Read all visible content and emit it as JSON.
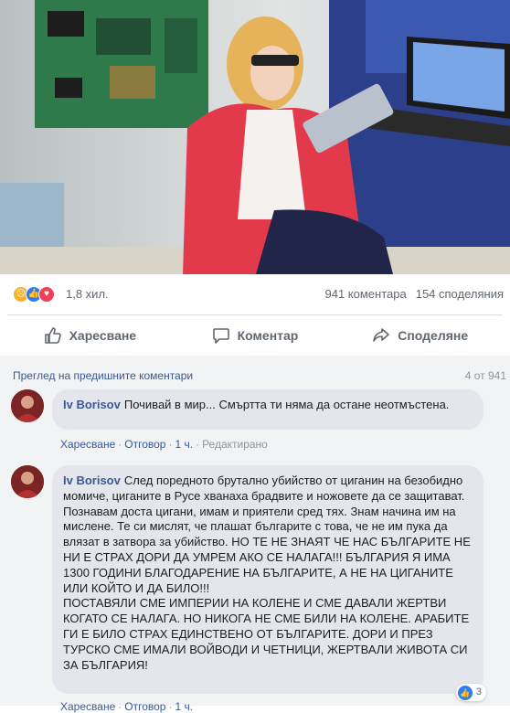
{
  "post": {
    "photo_alt": "Post photo",
    "reactions": {
      "icons": [
        "sad-reaction-icon",
        "like-reaction-icon",
        "love-reaction-icon"
      ],
      "count": "1,8 хил.",
      "comments_count": "941 коментара",
      "shares_count": "154 споделяния"
    },
    "actions": {
      "like": "Харесване",
      "comment": "Коментар",
      "share": "Споделяне"
    }
  },
  "comments": {
    "previous_link": "Преглед на предишните коментари",
    "position": "4 от 941",
    "items": [
      {
        "author": "Iv Borisov",
        "text": "Почивай в мир... Смъртта ти няма да остане неотмъстена.",
        "like": "Харесване",
        "reply": "Отговор",
        "time": "1 ч.",
        "edited": "Редактирано"
      },
      {
        "author": "Iv Borisov",
        "text": "След поредното брутално убийство от циганин на безобидно момиче, циганите в Русе хванаха брадвите и ножовете да се защитават. Познавам доста цигани, имам и приятели сред тях. Знам начина им на мислене. Те си мислят, че плашат българите с това, че не им пука да влязат в затвора за убийство. НО ТЕ НЕ ЗНАЯТ ЧЕ НАС БЪЛГАРИТЕ НЕ НИ Е СТРАХ ДОРИ ДА УМРЕМ АКО СЕ НАЛАГА!!! БЪЛГАРИЯ Я ИМА 1300 ГОДИНИ БЛАГОДАРЕНИЕ НА БЪЛГАРИТЕ, А НЕ НА ЦИГАНИТЕ ИЛИ КОЙТО И ДА БИЛО!!!\nПОСТАВЯЛИ СМЕ ИМПЕРИИ НА КОЛЕНЕ И СМЕ ДАВАЛИ ЖЕРТВИ КОГАТО СЕ НАЛАГА. НО НИКОГА НЕ СМЕ БИЛИ НА КОЛЕНЕ. АРАБИТЕ ГИ Е БИЛО СТРАХ ЕДИНСТВЕНО ОТ БЪЛГАРИТЕ. ДОРИ И ПРЕЗ ТУРСКО СМЕ ИМАЛИ ВОЙВОДИ И ЧЕТНИЦИ, ЖЕРТВАЛИ ЖИВОТА СИ ЗА БЪЛГАРИЯ!",
        "reaction_count": "3",
        "like": "Харесване",
        "reply": "Отговор",
        "time": "1 ч."
      }
    ]
  },
  "colors": {
    "link": "#385898",
    "muted": "#606770",
    "bubble": "#e4e6eb",
    "comments_bg": "#f2f3f5",
    "like_blue": "#2e7bf6",
    "love_red": "#f33e58",
    "sad_yellow": "#f7b125"
  }
}
